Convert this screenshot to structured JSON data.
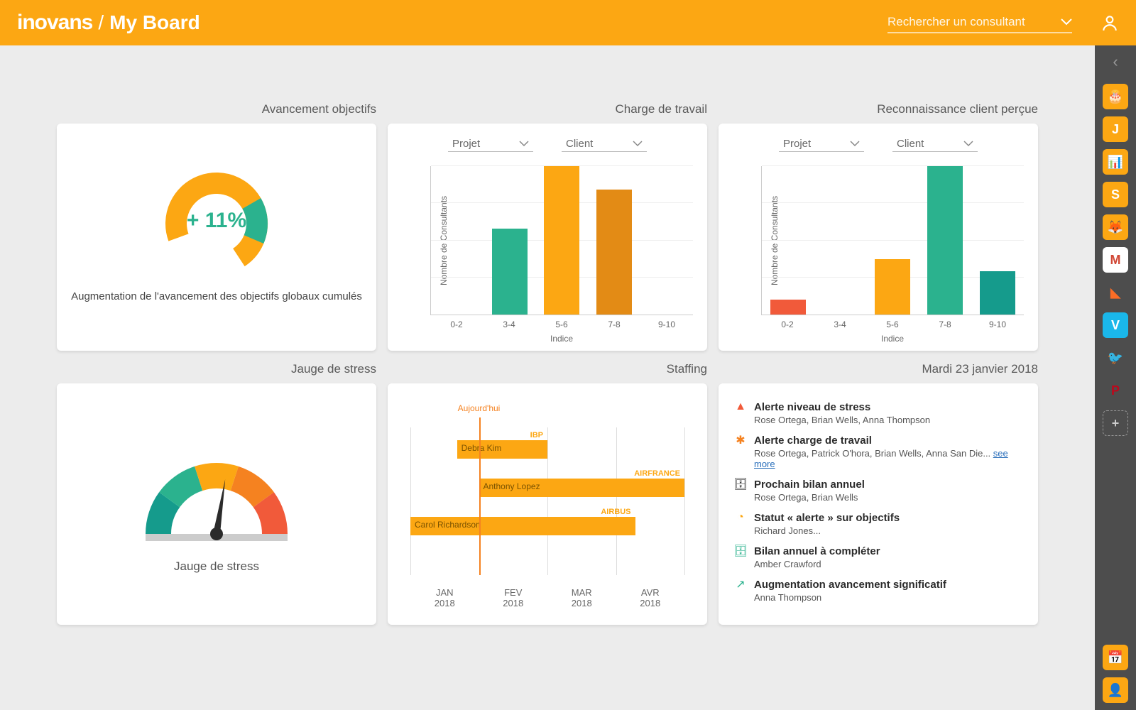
{
  "header": {
    "logo_brand": "inovans",
    "logo_slash": "/",
    "logo_page": "My Board",
    "search_placeholder": "Rechercher un consultant"
  },
  "cards": {
    "advancement": {
      "title": "Avancement objectifs",
      "value": "+ 11%",
      "caption": "Augmentation de l'avancement des objectifs globaux cumulés"
    },
    "workload": {
      "title": "Charge de travail",
      "selector1": "Projet",
      "selector2": "Client",
      "ylabel": "Nombre de Consultants",
      "xlabel": "Indice"
    },
    "recognition": {
      "title": "Reconnaissance client perçue",
      "selector1": "Projet",
      "selector2": "Client",
      "ylabel": "Nombre de Consultants",
      "xlabel": "Indice"
    },
    "stress": {
      "title": "Jauge de stress",
      "caption": "Jauge de stress"
    },
    "staffing": {
      "title": "Staffing",
      "today_label": "Aujourd'hui"
    },
    "today": {
      "title": "Mardi 23 janvier 2018"
    }
  },
  "chart_data": [
    {
      "id": "workload",
      "type": "bar",
      "categories": [
        "0-2",
        "3-4",
        "5-6",
        "7-8",
        "9-10"
      ],
      "values": [
        0,
        55,
        95,
        80,
        0
      ],
      "colors": [
        "#f15a3a",
        "#2bb28e",
        "#fca713",
        "#e38b15",
        "#159b8c"
      ],
      "ylabel": "Nombre de Consultants",
      "xlabel": "Indice"
    },
    {
      "id": "recognition",
      "type": "bar",
      "categories": [
        "0-2",
        "3-4",
        "5-6",
        "7-8",
        "9-10"
      ],
      "values": [
        12,
        0,
        45,
        120,
        35
      ],
      "colors": [
        "#f15a3a",
        "#2bb28e",
        "#fca713",
        "#2bb28e",
        "#159b8c"
      ],
      "ylabel": "Nombre de Consultants",
      "xlabel": "Indice"
    },
    {
      "id": "advancement_donut",
      "type": "pie",
      "value_pct": 11,
      "primary_color": "#fca713",
      "secondary_color": "#2bb28e"
    },
    {
      "id": "stress_gauge",
      "type": "gauge",
      "value": 0.55,
      "segments": [
        "#159b8c",
        "#2bb28e",
        "#fca713",
        "#f58220",
        "#f15a3a"
      ]
    },
    {
      "id": "staffing_gantt",
      "type": "gantt",
      "months": [
        "JAN 2018",
        "FEV 2018",
        "MAR 2018",
        "AVR 2018"
      ],
      "today_fraction": 0.25,
      "rows": [
        {
          "name": "Debra Kim",
          "client": "IBP",
          "start": 0.17,
          "end": 0.5
        },
        {
          "name": "Anthony Lopez",
          "client": "AIRFRANCE",
          "start": 0.25,
          "end": 1.0
        },
        {
          "name": "Carol Richardson",
          "client": "AIRBUS",
          "start": 0.0,
          "end": 0.82
        }
      ]
    }
  ],
  "alerts": [
    {
      "icon": "warning",
      "color": "#f15a3a",
      "title": "Alerte niveau de stress",
      "detail": "Rose Ortega, Brian Wells, Anna Thompson"
    },
    {
      "icon": "burst",
      "color": "#f58220",
      "title": "Alerte charge de travail",
      "detail": "Rose Ortega, Patrick O'hora, Brian Wells, Anna San Die...",
      "see_more": "see more"
    },
    {
      "icon": "briefcase",
      "color": "#333",
      "title": "Prochain bilan annuel",
      "detail": "Rose Ortega, Brian Wells"
    },
    {
      "icon": "donut",
      "color": "#fca713",
      "title": "Statut « alerte » sur objectifs",
      "detail": "Richard Jones..."
    },
    {
      "icon": "briefcase",
      "color": "#2bb28e",
      "title": "Bilan annuel à compléter",
      "detail": "Amber Crawford"
    },
    {
      "icon": "arrow",
      "color": "#2bb28e",
      "title": "Augmentation avancement significatif",
      "detail": "Anna Thompson"
    }
  ],
  "sidebar": {
    "icons": [
      {
        "id": "cake",
        "bg": "#fca713"
      },
      {
        "id": "J",
        "bg": "#fca713"
      },
      {
        "id": "chart",
        "bg": "#fca713"
      },
      {
        "id": "S",
        "bg": "#fca713"
      },
      {
        "id": "firefox",
        "bg": "#fca713"
      },
      {
        "id": "gmail",
        "bg": "#fff"
      },
      {
        "id": "gitlab",
        "bg": "transparent"
      },
      {
        "id": "vimeo",
        "bg": "#1ab7ea"
      },
      {
        "id": "twitter",
        "bg": "transparent"
      },
      {
        "id": "pinterest",
        "bg": "transparent"
      },
      {
        "id": "add",
        "bg": "transparent"
      }
    ],
    "bottom": [
      {
        "id": "calendar-add",
        "bg": "#fca713"
      },
      {
        "id": "user-add",
        "bg": "#fca713"
      }
    ]
  }
}
